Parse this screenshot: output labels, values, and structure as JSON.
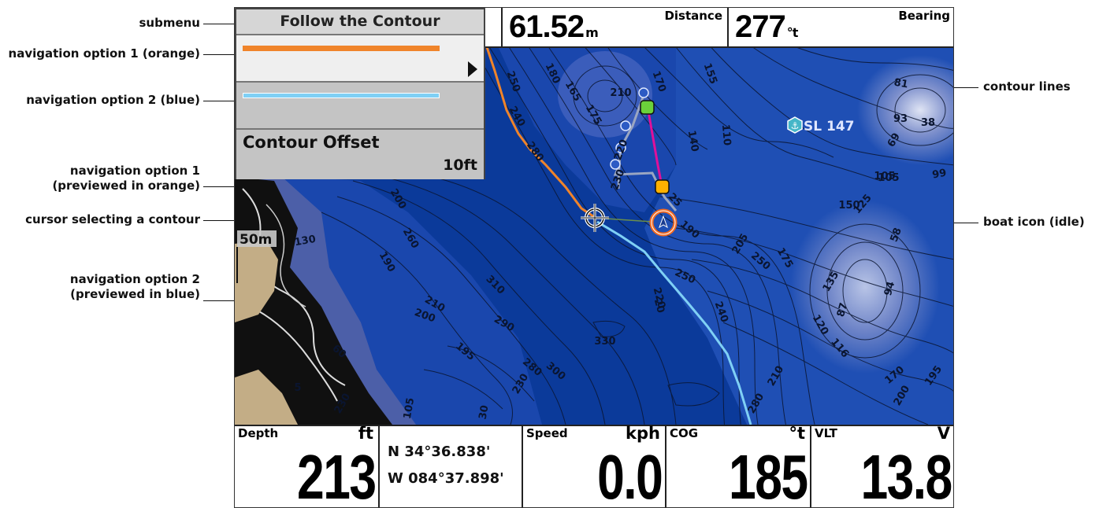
{
  "submenu": {
    "title": "Follow the Contour",
    "option1_color": "#f0842a",
    "option2_color": "#7fd0f5",
    "selected_arrow": "right-arrow-icon",
    "offset_label": "Contour Offset",
    "offset_value": "10ft"
  },
  "top_bar": {
    "distance": {
      "value": "61.52",
      "unit": "m",
      "label": "Distance"
    },
    "bearing": {
      "value": "277",
      "unit": "°t",
      "label": "Bearing"
    }
  },
  "map": {
    "scale_label": "50m",
    "waypoint_label": "SL 147",
    "waypoint_icon": "anchor-icon",
    "depth_labels": [
      "180",
      "165",
      "250",
      "240",
      "280",
      "175",
      "210",
      "170",
      "155",
      "140",
      "110",
      "230",
      "220",
      "25",
      "190",
      "130",
      "190",
      "260",
      "200",
      "310",
      "250",
      "200",
      "210",
      "290",
      "330",
      "220",
      "240",
      "250",
      "175",
      "135",
      "205",
      "125",
      "58",
      "87",
      "94",
      "120",
      "116",
      "170",
      "200",
      "195",
      "105",
      "93",
      "81",
      "38",
      "69",
      "99",
      "150",
      "105",
      "230",
      "300",
      "280",
      "195",
      "105",
      "60",
      "5",
      "230",
      "210",
      "280",
      "30",
      "20"
    ]
  },
  "bottom_bar": {
    "depth": {
      "label": "Depth",
      "unit": "ft",
      "value": "213"
    },
    "position": {
      "lat": "N 34°36.838'",
      "lon": "W 084°37.898'"
    },
    "speed": {
      "label": "Speed",
      "unit": "kph",
      "value": "0.0"
    },
    "cog": {
      "label": "COG",
      "unit": "°t",
      "value": "185"
    },
    "vlt": {
      "label": "VLT",
      "unit": "V",
      "value": "13.8"
    }
  },
  "callouts": {
    "submenu": "submenu",
    "nav_option_1": "navigation option 1 (orange)",
    "nav_option_2": "navigation option 2 (blue)",
    "nav_option_1_preview_line1": "navigation option 1",
    "nav_option_1_preview_line2": "(previewed in orange)",
    "cursor": "cursor selecting a contour",
    "nav_option_2_preview_line1": "navigation option 2",
    "nav_option_2_preview_line2": "(previewed in blue)",
    "contour_lines": "contour lines",
    "boat_icon": "boat icon (idle)"
  },
  "colors": {
    "water_deep": "#0b3a9a",
    "water_mid": "#1f4fb4",
    "shallow": "#5b6fb8",
    "land": "#c3ad86",
    "contour": "#0a1530",
    "route_magenta": "#e0109a",
    "track_gray": "#9aa6c2",
    "boat_orange": "#f26a21"
  }
}
